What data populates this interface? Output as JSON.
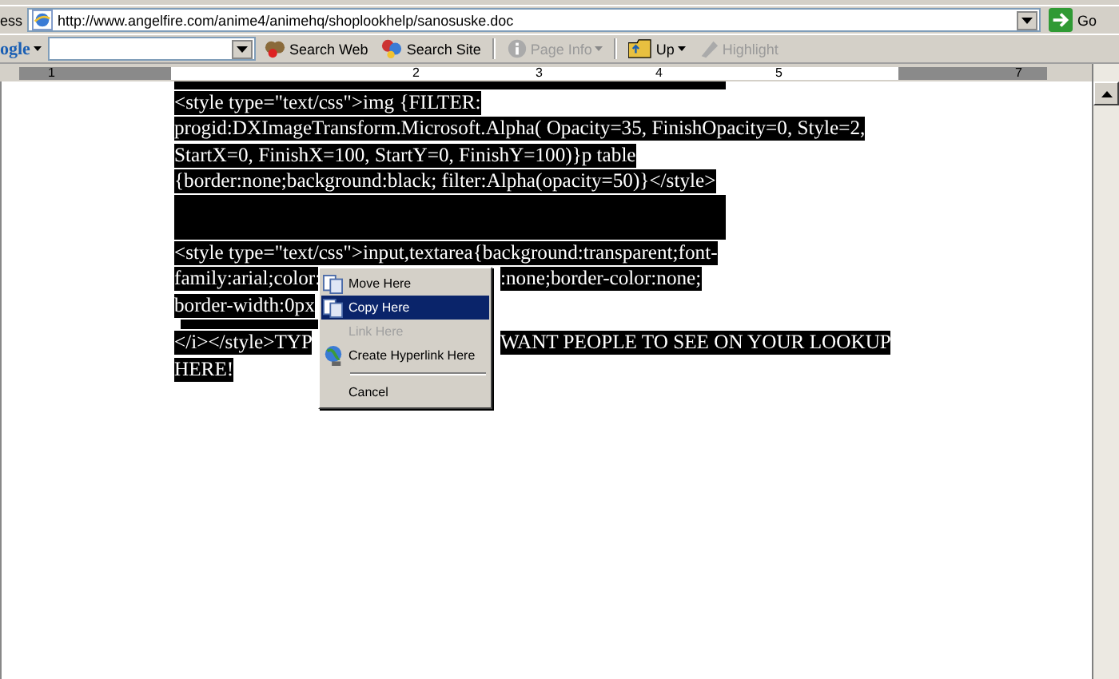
{
  "address_bar": {
    "label": "ess",
    "url": "http://www.angelfire.com/anime4/animehq/shoplookhelp/sanosuske.doc",
    "go_button": "Go"
  },
  "google_toolbar": {
    "logo": "ogle",
    "buttons": [
      {
        "label": "Search Web",
        "disabled": false,
        "caret": false
      },
      {
        "label": "Search Site",
        "disabled": false,
        "caret": false
      },
      {
        "label": "Page Info",
        "disabled": true,
        "caret": true
      },
      {
        "label": "Up",
        "disabled": false,
        "caret": true
      },
      {
        "label": "Highlight",
        "disabled": true,
        "caret": false
      }
    ]
  },
  "ruler": {
    "numbers": [
      "1",
      "2",
      "3",
      "4",
      "5",
      "7"
    ]
  },
  "document": {
    "lines": [
      {
        "kind": "text",
        "parts": [
          "<style type=\"text/css\">img {FILTER:"
        ]
      },
      {
        "kind": "text",
        "parts": [
          "progid:DXImageTransform.Microsoft.Alpha( Opacity=35, FinishOpacity=0, Style=2,"
        ]
      },
      {
        "kind": "text",
        "parts": [
          "StartX=0,  FinishX=100, StartY=0, FinishY=100)}p table"
        ]
      },
      {
        "kind": "text",
        "parts": [
          "{border:none;background:black; filter:Alpha(opacity=50)}</style>"
        ]
      },
      {
        "kind": "blank"
      },
      {
        "kind": "text",
        "parts": [
          "<style type=\"text/css\">input,textarea{background:transparent;font-"
        ]
      },
      {
        "kind": "text",
        "parts": [
          "family:arial;color:",
          ":none;border-color:none;"
        ]
      },
      {
        "kind": "text",
        "parts": [
          "border-width:0px"
        ]
      },
      {
        "kind": "small_blank"
      },
      {
        "kind": "text",
        "parts": [
          "</i></style>TYP",
          "WANT PEOPLE TO SEE ON YOUR LOOKUP"
        ]
      },
      {
        "kind": "text",
        "parts": [
          "HERE!"
        ]
      }
    ]
  },
  "context_menu": {
    "items": [
      {
        "kind": "item",
        "label": "Move Here",
        "selected": false,
        "disabled": false
      },
      {
        "kind": "item",
        "label": "Copy Here",
        "selected": true,
        "disabled": false
      },
      {
        "kind": "item",
        "label": "Link Here",
        "selected": false,
        "disabled": true
      },
      {
        "kind": "item",
        "label": "Create Hyperlink Here",
        "selected": false,
        "disabled": false
      },
      {
        "kind": "separator"
      },
      {
        "kind": "item",
        "label": "Cancel",
        "selected": false,
        "disabled": false
      }
    ]
  }
}
